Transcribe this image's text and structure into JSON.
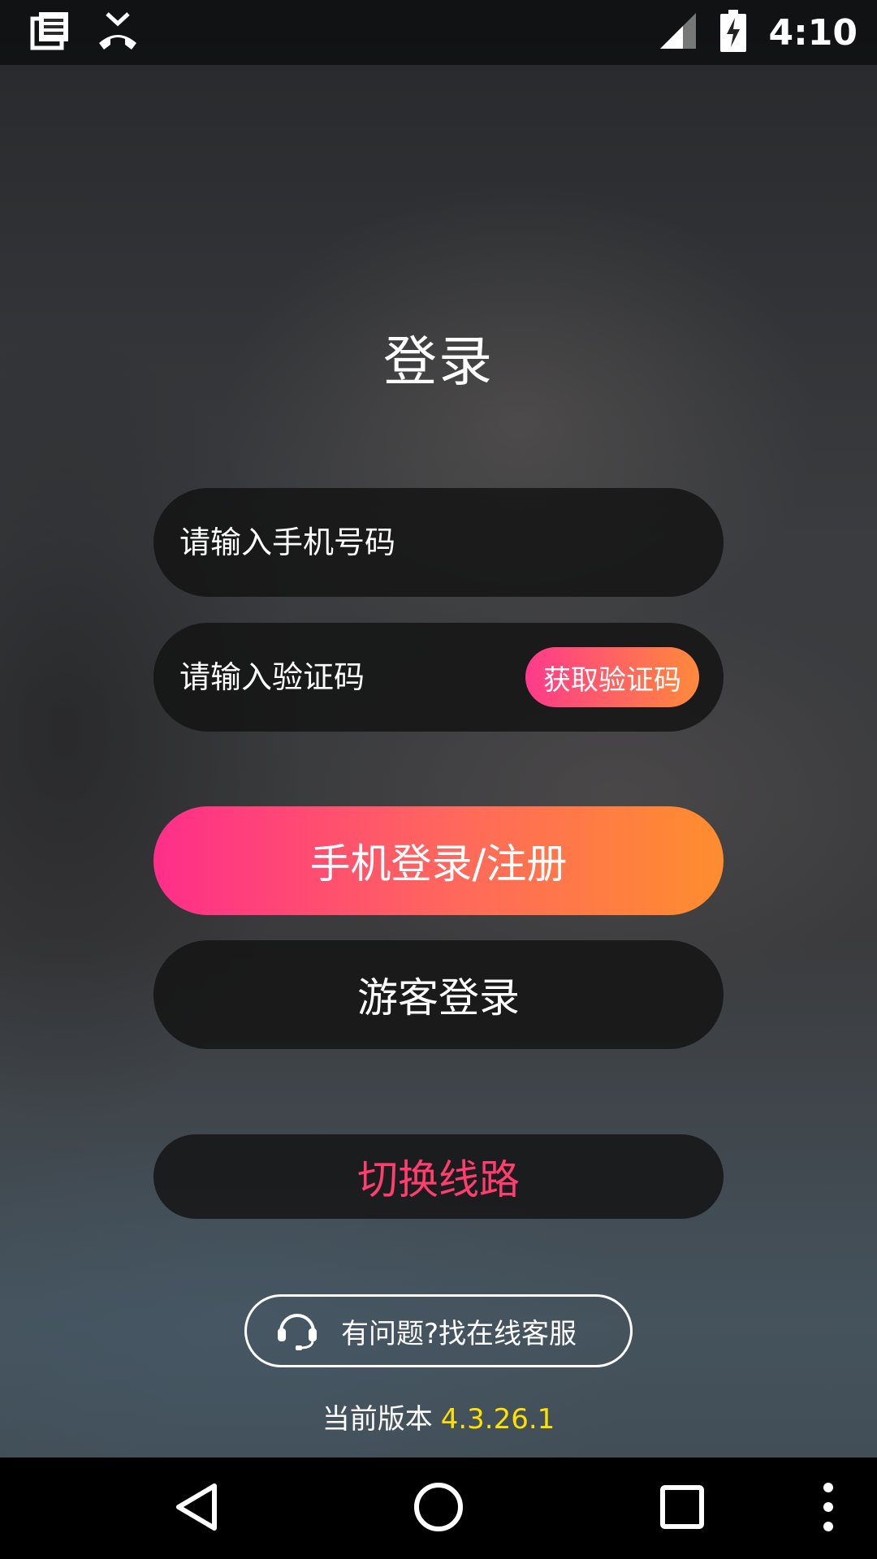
{
  "status_bar": {
    "time": "4:10",
    "icons": [
      "notes-icon",
      "missed-call-icon",
      "signal-icon",
      "battery-charging-icon"
    ]
  },
  "login": {
    "title": "登录",
    "phone_placeholder": "请输入手机号码",
    "code_placeholder": "请输入验证码",
    "get_code_label": "获取验证码",
    "phone_login_label": "手机登录/注册",
    "guest_login_label": "游客登录",
    "switch_line_label": "切换线路",
    "help_label": "有问题?找在线客服",
    "version_label": "当前版本",
    "version_number": "4.3.26.1"
  },
  "nav_bar": {
    "icons": [
      "back-icon",
      "home-icon",
      "recents-icon",
      "more-icon"
    ]
  },
  "colors": {
    "gradient_start": "#ff2e8a",
    "gradient_end": "#ff8d2e",
    "switch_text": "#ff3d6e",
    "version_number": "#ffe100"
  }
}
